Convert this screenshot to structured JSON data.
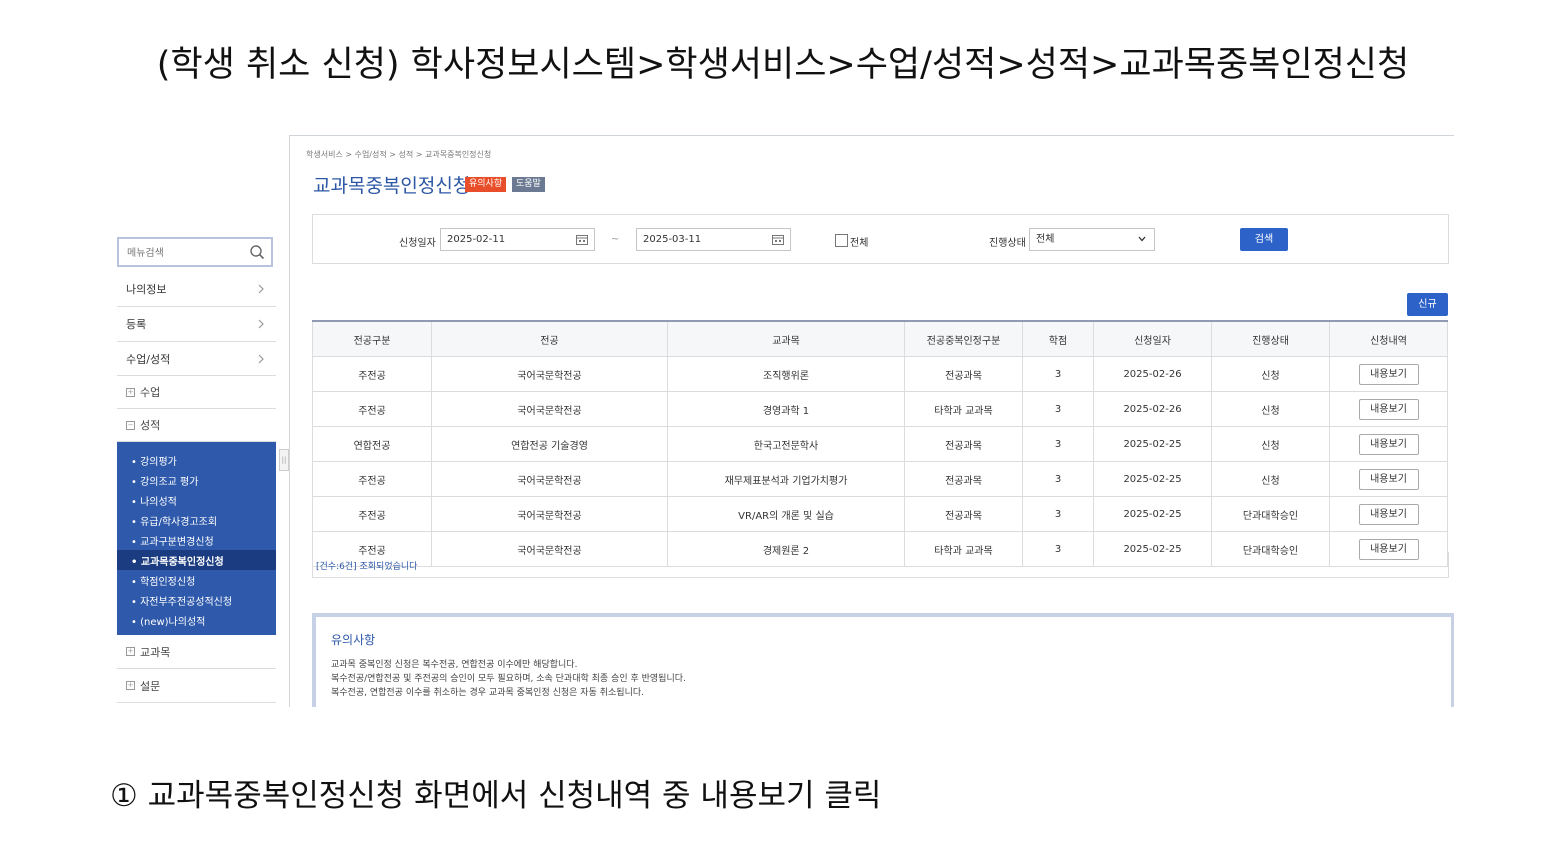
{
  "doc": {
    "title": "(학생 취소 신청) 학사정보시스템>학생서비스>수업/성적>성적>교과목중복인정신청",
    "caption": "① 교과목중복인정신청 화면에서 신청내역 중 내용보기 클릭"
  },
  "sidebar": {
    "search_placeholder": "메뉴검색",
    "menus": [
      {
        "label": "나의정보"
      },
      {
        "label": "등록"
      },
      {
        "label": "수업/성적"
      }
    ],
    "subs": [
      {
        "label": "수업"
      },
      {
        "label": "성적"
      }
    ],
    "grade_items": [
      {
        "label": "• 강의평가",
        "active": false
      },
      {
        "label": "• 강의조교 평가",
        "active": false
      },
      {
        "label": "• 나의성적",
        "active": false
      },
      {
        "label": "• 유급/학사경고조회",
        "active": false
      },
      {
        "label": "• 교과구분변경신청",
        "active": false
      },
      {
        "label": "• 교과목중복인정신청",
        "active": true
      },
      {
        "label": "• 학점인정신청",
        "active": false
      },
      {
        "label": "• 자전부주전공성적신청",
        "active": false
      },
      {
        "label": "• (new)나의성적",
        "active": false
      }
    ],
    "bottom_subs": [
      {
        "label": "교과목"
      },
      {
        "label": "설문"
      }
    ]
  },
  "page": {
    "breadcrumb": "학생서비스 > 수업/성적 > 성적 > 교과목중복인정신청",
    "title": "교과목중복인정신청",
    "badge_notice": "유의사항",
    "badge_help": "도움말"
  },
  "search": {
    "date_label": "신청일자",
    "date_from": "2025-02-11",
    "tilde": "~",
    "date_to": "2025-03-11",
    "all_label": "전체",
    "status_label": "진행상태",
    "status_value": "전체",
    "search_button": "검색"
  },
  "new_button": "신규",
  "table": {
    "headers": [
      "전공구분",
      "전공",
      "교과목",
      "전공중복인정구분",
      "학점",
      "신청일자",
      "진행상태",
      "신청내역"
    ],
    "rows": [
      [
        "주전공",
        "국어국문학전공",
        "조직행위론",
        "전공과목",
        "3",
        "2025-02-26",
        "신청",
        "내용보기"
      ],
      [
        "주전공",
        "국어국문학전공",
        "경영과학 1",
        "타학과 교과목",
        "3",
        "2025-02-26",
        "신청",
        "내용보기"
      ],
      [
        "연합전공",
        "연합전공 기술경영",
        "한국고전문학사",
        "전공과목",
        "3",
        "2025-02-25",
        "신청",
        "내용보기"
      ],
      [
        "주전공",
        "국어국문학전공",
        "재무제표분석과 기업가치평가",
        "전공과목",
        "3",
        "2025-02-25",
        "신청",
        "내용보기"
      ],
      [
        "주전공",
        "국어국문학전공",
        "VR/AR의 개론 및 실습",
        "전공과목",
        "3",
        "2025-02-25",
        "단과대학승인",
        "내용보기"
      ],
      [
        "주전공",
        "국어국문학전공",
        "경제원론 2",
        "타학과 교과목",
        "3",
        "2025-02-25",
        "단과대학승인",
        "내용보기"
      ]
    ],
    "count_text": "[건수:6건] 조회되었습니다"
  },
  "step_mark": "①",
  "notice": {
    "title": "유의사항",
    "lines": [
      "교과목 중복인정 신청은 복수전공, 연합전공 이수에만 해당합니다.",
      "복수전공/연합전공 및 주전공의 승인이 모두 필요하며, 소속 단과대학 최종 승인 후 반영됩니다.",
      "복수전공, 연합전공 이수를 취소하는 경우 교과목 중복인정 신청은 자동 취소됩니다."
    ]
  },
  "colors": {
    "accent": "#2c57a6",
    "panel": "#2f5aab",
    "highlight": "#e01a1a"
  }
}
